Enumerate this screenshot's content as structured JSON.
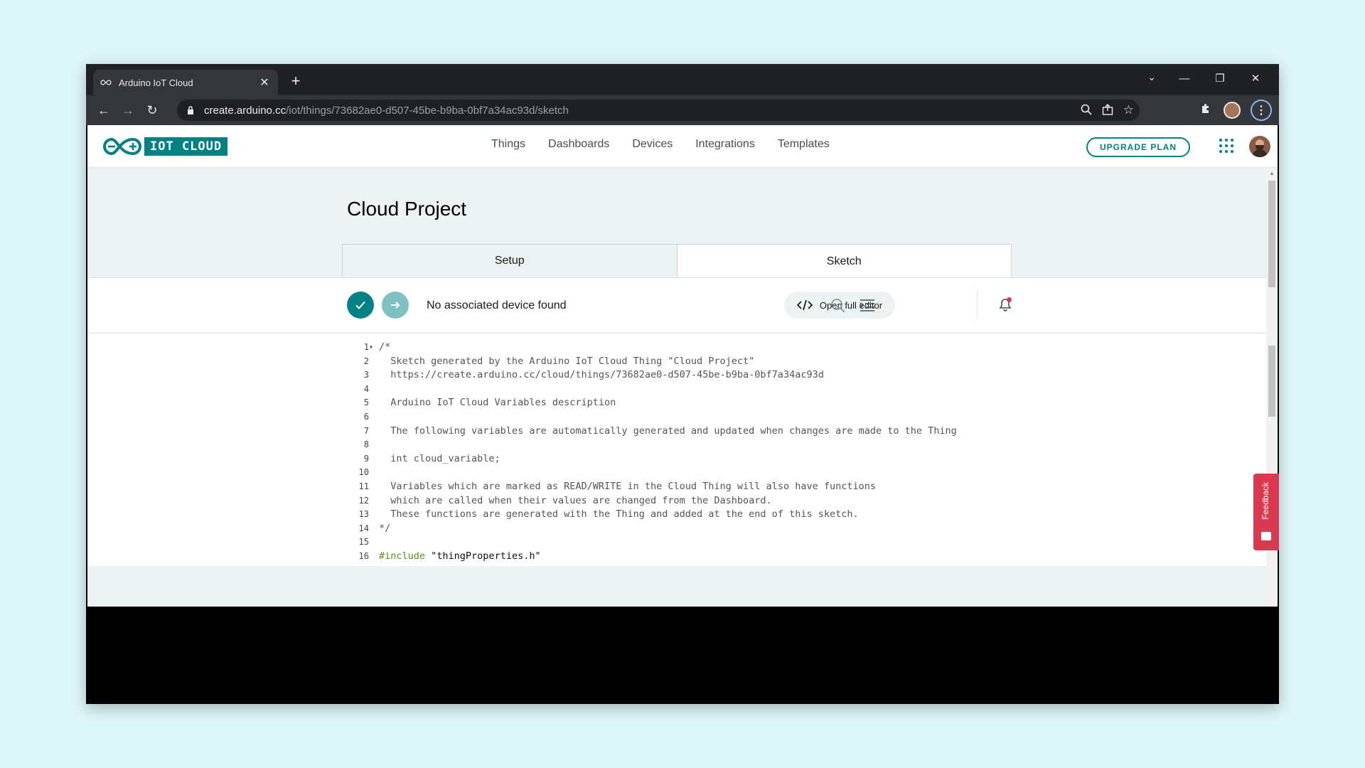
{
  "browser": {
    "tab_title": "Arduino IoT Cloud",
    "tab_close": "✕",
    "new_tab": "+",
    "url_host": "create.arduino.cc",
    "url_path": "/iot/things/73682ae0-d507-45be-b9ba-0bf7a34ac93d/sketch"
  },
  "app": {
    "brand": "IOT CLOUD",
    "nav": [
      "Things",
      "Dashboards",
      "Devices",
      "Integrations",
      "Templates"
    ],
    "upgrade_label": "UPGRADE PLAN"
  },
  "project": {
    "title": "Cloud Project",
    "tabs": [
      "Setup",
      "Sketch"
    ],
    "device_status": "No associated device found",
    "open_editor_label": "Open full editor"
  },
  "code_lines": [
    {
      "n": "1",
      "text": "/*"
    },
    {
      "n": "2",
      "text": "  Sketch generated by the Arduino IoT Cloud Thing \"Cloud Project\""
    },
    {
      "n": "3",
      "text": "  https://create.arduino.cc/cloud/things/73682ae0-d507-45be-b9ba-0bf7a34ac93d"
    },
    {
      "n": "4",
      "text": ""
    },
    {
      "n": "5",
      "text": "  Arduino IoT Cloud Variables description"
    },
    {
      "n": "6",
      "text": ""
    },
    {
      "n": "7",
      "text": "  The following variables are automatically generated and updated when changes are made to the Thing"
    },
    {
      "n": "8",
      "text": ""
    },
    {
      "n": "9",
      "text": "  int cloud_variable;"
    },
    {
      "n": "10",
      "text": ""
    },
    {
      "n": "11",
      "text": "  Variables which are marked as READ/WRITE in the Cloud Thing will also have functions"
    },
    {
      "n": "12",
      "text": "  which are called when their values are changed from the Dashboard."
    },
    {
      "n": "13",
      "text": "  These functions are generated with the Thing and added at the end of this sketch."
    },
    {
      "n": "14",
      "text": "*/"
    },
    {
      "n": "15",
      "text": ""
    },
    {
      "n": "16",
      "directive": "#include",
      "string": " \"thingProperties.h\""
    }
  ],
  "feedback_label": "Feedback",
  "colors": {
    "accent": "#008184",
    "feedback": "#da3a4f"
  }
}
